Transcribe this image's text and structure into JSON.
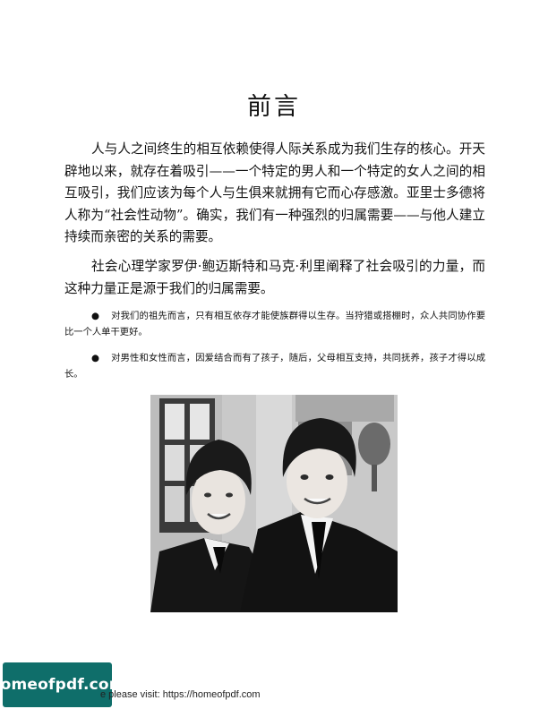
{
  "page": {
    "title": "前言",
    "paragraphs": [
      "人与人之间终生的相互依赖使得人际关系成为我们生存的核心。开天辟地以来，就存在着吸引——一个特定的男人和一个特定的女人之间的相互吸引，我们应该为每个人与生俱来就拥有它而心存感激。亚里士多德将人称为“社会性动物”。确实，我们有一种强烈的归属需要——与他人建立持续而亲密的关系的需要。",
      "社会心理学家罗伊·鲍迈斯特和马克·利里阐释了社会吸引的力量，而这种力量正是源于我们的归属需要。"
    ],
    "bullets": [
      "对我们的祖先而言，只有相互依存才能使族群得以生存。当狩猎或搭棚时，众人共同协作要比一个人单干更好。",
      "对男性和女性而言，因爱结合而有了孩子，随后，父母相互支持，共同抚养，孩子才得以成长。"
    ],
    "bullet_symbol": "●"
  },
  "watermark": {
    "logo_text": "homeofpdf.com",
    "footer_text": "e please visit: https://homeofpdf.com",
    "logo_color": "#0f6e6a"
  }
}
